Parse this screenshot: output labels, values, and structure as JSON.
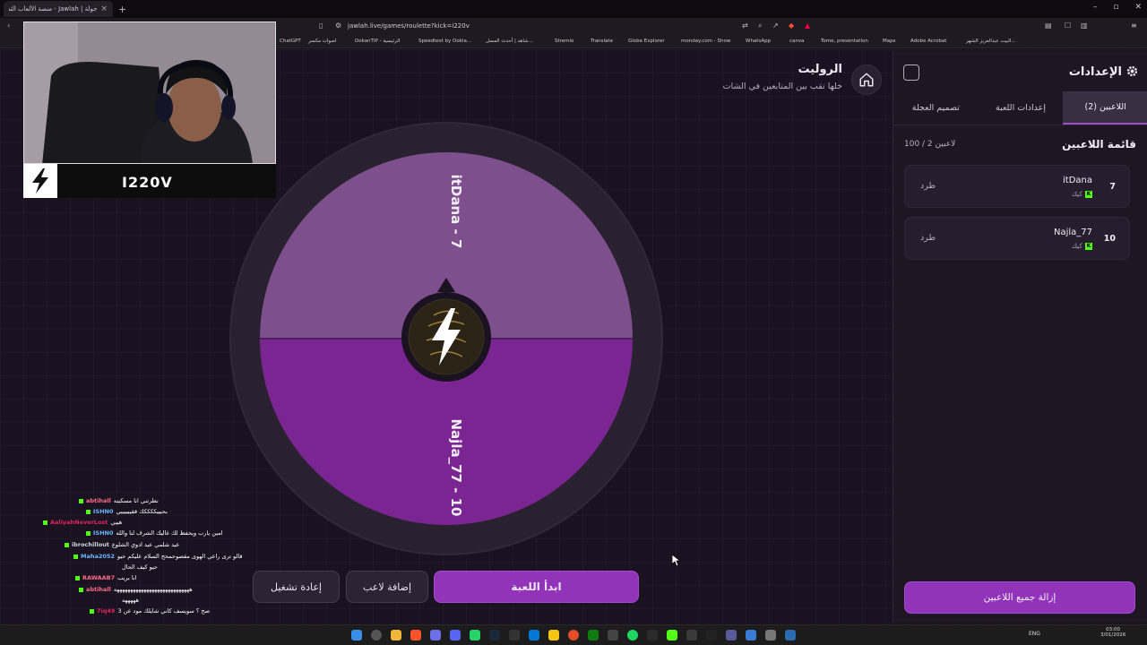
{
  "browser": {
    "tab_title": "جولة | Jawlah - منصة الألعاب التفا...",
    "url": "jawlah.live/games/roulette?kick=i220v",
    "bookmarks": [
      "ChatGPT",
      "اصوات مكسر",
      "DokanTIP - الرئيسية",
      "Speedtest by Ookla...",
      "شاهد | أحدث المسل...",
      "Stremio",
      "Translate",
      "Globe Explorer",
      "monday.com - Show",
      "WhatsApp",
      "canva",
      "Tome, presentation",
      "Maps",
      "Adobe Acrobat",
      "البيت عبدالعزيز الشهر..."
    ]
  },
  "header": {
    "title": "الروليت",
    "subtitle": "خلها تقب بين المتابعين في الشات"
  },
  "wheel": {
    "segments": [
      {
        "label": "itDana - 7",
        "color": "#7d4f8d"
      },
      {
        "label": "Najla_77 - 10",
        "color": "#7a2591"
      }
    ]
  },
  "buttons": {
    "start": "ابدأ اللعبة",
    "add_player": "إضافة لاعب",
    "restart": "إعادة تشغيل"
  },
  "panel": {
    "title": "الإعدادات",
    "tabs": [
      "اللاعبين (2)",
      "إعدادات اللعبة",
      "تصميم العجلة"
    ],
    "list_title": "قائمة اللاعبين",
    "count": "100 / 2 لاعبين",
    "players": [
      {
        "num": "7",
        "name": "itDana",
        "source": "كيك",
        "kick": "طرد"
      },
      {
        "num": "10",
        "name": "Najla_77",
        "source": "كيك",
        "kick": "طرد"
      }
    ],
    "remove_all": "إزالة جميع اللاعبين"
  },
  "stream": {
    "name": "I220V"
  },
  "chat": [
    {
      "user": "abtihall",
      "color": "#ff6b8a",
      "text": "نطرتني انا مسكينه"
    },
    {
      "user": "ISHN0",
      "color": "#6ab8ff",
      "text": "بحبييككككك ققييييييي"
    },
    {
      "user": "AaliyahNeverLost",
      "color": "#e0245e",
      "text": "هييي"
    },
    {
      "user": "ISHN0",
      "color": "#6ab8ff",
      "text": "امين يارب ويحفظ لك غاليك الشرف لنا والله"
    },
    {
      "user": "ibrochillout",
      "color": "#cfd8dc",
      "text": "عيد شلمي عيد ادوي الشلوع"
    },
    {
      "user": "Maha2052",
      "color": "#6ab8ff",
      "text": "قالو ترى راعي الهوى مقصوحمحح السلام عليكم حيو"
    },
    {
      "user": "",
      "color": "#ffffff",
      "text": "حيو كيف الحال"
    },
    {
      "user": "RAWAAB7",
      "color": "#ff6b8a",
      "text": "انا بريب"
    },
    {
      "user": "abtihall",
      "color": "#ff6b8a",
      "text": "ههههههههههههههههههههههههههههه"
    },
    {
      "user": "",
      "color": "#ffffff",
      "text": "هههههه"
    },
    {
      "user": "7iq49",
      "color": "#e0245e",
      "text": "صح ؟ سويسف كاني شايلك مود عن 3"
    }
  ],
  "taskbar": {
    "lang": "ENG",
    "time": "03:00",
    "date": "3/01/2026"
  }
}
